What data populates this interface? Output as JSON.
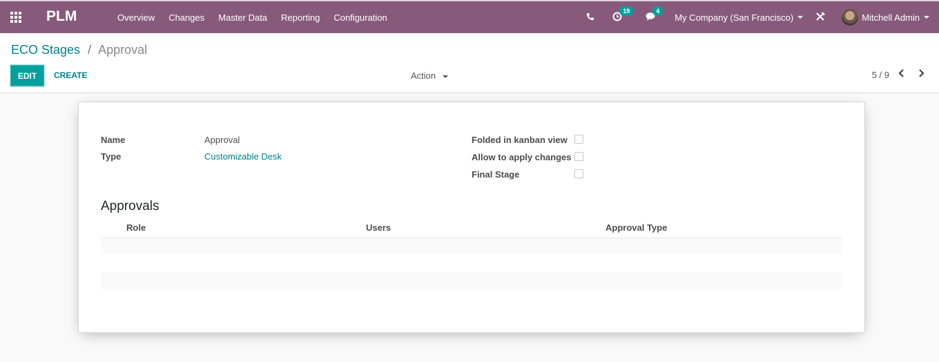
{
  "navbar": {
    "app_title": "PLM",
    "menu": [
      "Overview",
      "Changes",
      "Master Data",
      "Reporting",
      "Configuration"
    ],
    "activity_count": "19",
    "messages_count": "4",
    "company": "My Company (San Francisco)",
    "user": "Mitchell Admin"
  },
  "breadcrumb": {
    "parent": "ECO Stages",
    "separator": "/",
    "current": "Approval"
  },
  "toolbar": {
    "edit_label": "EDIT",
    "create_label": "CREATE",
    "action_label": "Action",
    "pager": "5 / 9"
  },
  "form": {
    "name_label": "Name",
    "name_value": "Approval",
    "type_label": "Type",
    "type_value": "Customizable Desk",
    "folded_label": "Folded in kanban view",
    "folded_value": false,
    "allow_label": "Allow to apply changes",
    "allow_value": false,
    "final_label": "Final Stage",
    "final_value": false
  },
  "approvals": {
    "title": "Approvals",
    "columns": [
      "Role",
      "Users",
      "Approval Type"
    ],
    "rows": []
  },
  "colors": {
    "brand": "#875a7b",
    "accent": "#00a09d",
    "link": "#00808a"
  }
}
